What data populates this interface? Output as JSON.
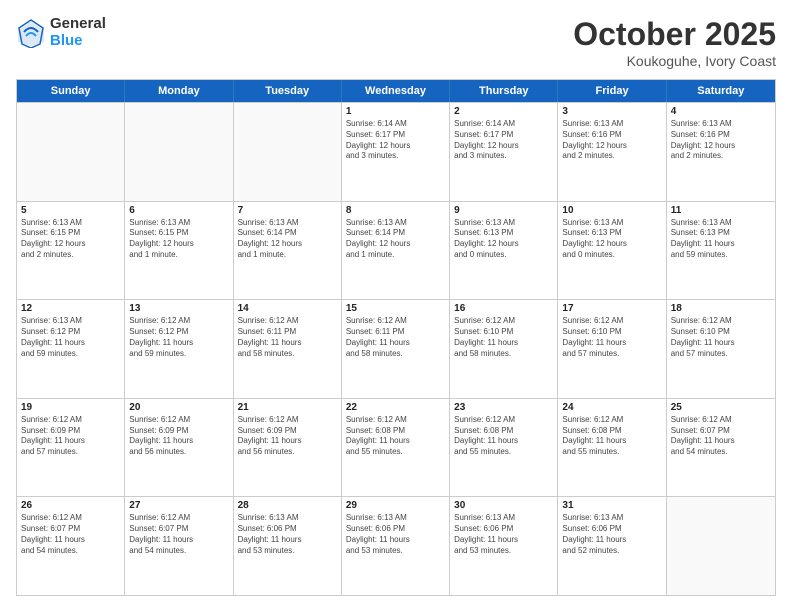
{
  "logo": {
    "general": "General",
    "blue": "Blue"
  },
  "title": "October 2025",
  "subtitle": "Koukoguhe, Ivory Coast",
  "days": [
    "Sunday",
    "Monday",
    "Tuesday",
    "Wednesday",
    "Thursday",
    "Friday",
    "Saturday"
  ],
  "weeks": [
    [
      {
        "day": "",
        "info": ""
      },
      {
        "day": "",
        "info": ""
      },
      {
        "day": "",
        "info": ""
      },
      {
        "day": "1",
        "info": "Sunrise: 6:14 AM\nSunset: 6:17 PM\nDaylight: 12 hours\nand 3 minutes."
      },
      {
        "day": "2",
        "info": "Sunrise: 6:14 AM\nSunset: 6:17 PM\nDaylight: 12 hours\nand 3 minutes."
      },
      {
        "day": "3",
        "info": "Sunrise: 6:13 AM\nSunset: 6:16 PM\nDaylight: 12 hours\nand 2 minutes."
      },
      {
        "day": "4",
        "info": "Sunrise: 6:13 AM\nSunset: 6:16 PM\nDaylight: 12 hours\nand 2 minutes."
      }
    ],
    [
      {
        "day": "5",
        "info": "Sunrise: 6:13 AM\nSunset: 6:15 PM\nDaylight: 12 hours\nand 2 minutes."
      },
      {
        "day": "6",
        "info": "Sunrise: 6:13 AM\nSunset: 6:15 PM\nDaylight: 12 hours\nand 1 minute."
      },
      {
        "day": "7",
        "info": "Sunrise: 6:13 AM\nSunset: 6:14 PM\nDaylight: 12 hours\nand 1 minute."
      },
      {
        "day": "8",
        "info": "Sunrise: 6:13 AM\nSunset: 6:14 PM\nDaylight: 12 hours\nand 1 minute."
      },
      {
        "day": "9",
        "info": "Sunrise: 6:13 AM\nSunset: 6:13 PM\nDaylight: 12 hours\nand 0 minutes."
      },
      {
        "day": "10",
        "info": "Sunrise: 6:13 AM\nSunset: 6:13 PM\nDaylight: 12 hours\nand 0 minutes."
      },
      {
        "day": "11",
        "info": "Sunrise: 6:13 AM\nSunset: 6:13 PM\nDaylight: 11 hours\nand 59 minutes."
      }
    ],
    [
      {
        "day": "12",
        "info": "Sunrise: 6:13 AM\nSunset: 6:12 PM\nDaylight: 11 hours\nand 59 minutes."
      },
      {
        "day": "13",
        "info": "Sunrise: 6:12 AM\nSunset: 6:12 PM\nDaylight: 11 hours\nand 59 minutes."
      },
      {
        "day": "14",
        "info": "Sunrise: 6:12 AM\nSunset: 6:11 PM\nDaylight: 11 hours\nand 58 minutes."
      },
      {
        "day": "15",
        "info": "Sunrise: 6:12 AM\nSunset: 6:11 PM\nDaylight: 11 hours\nand 58 minutes."
      },
      {
        "day": "16",
        "info": "Sunrise: 6:12 AM\nSunset: 6:10 PM\nDaylight: 11 hours\nand 58 minutes."
      },
      {
        "day": "17",
        "info": "Sunrise: 6:12 AM\nSunset: 6:10 PM\nDaylight: 11 hours\nand 57 minutes."
      },
      {
        "day": "18",
        "info": "Sunrise: 6:12 AM\nSunset: 6:10 PM\nDaylight: 11 hours\nand 57 minutes."
      }
    ],
    [
      {
        "day": "19",
        "info": "Sunrise: 6:12 AM\nSunset: 6:09 PM\nDaylight: 11 hours\nand 57 minutes."
      },
      {
        "day": "20",
        "info": "Sunrise: 6:12 AM\nSunset: 6:09 PM\nDaylight: 11 hours\nand 56 minutes."
      },
      {
        "day": "21",
        "info": "Sunrise: 6:12 AM\nSunset: 6:09 PM\nDaylight: 11 hours\nand 56 minutes."
      },
      {
        "day": "22",
        "info": "Sunrise: 6:12 AM\nSunset: 6:08 PM\nDaylight: 11 hours\nand 55 minutes."
      },
      {
        "day": "23",
        "info": "Sunrise: 6:12 AM\nSunset: 6:08 PM\nDaylight: 11 hours\nand 55 minutes."
      },
      {
        "day": "24",
        "info": "Sunrise: 6:12 AM\nSunset: 6:08 PM\nDaylight: 11 hours\nand 55 minutes."
      },
      {
        "day": "25",
        "info": "Sunrise: 6:12 AM\nSunset: 6:07 PM\nDaylight: 11 hours\nand 54 minutes."
      }
    ],
    [
      {
        "day": "26",
        "info": "Sunrise: 6:12 AM\nSunset: 6:07 PM\nDaylight: 11 hours\nand 54 minutes."
      },
      {
        "day": "27",
        "info": "Sunrise: 6:12 AM\nSunset: 6:07 PM\nDaylight: 11 hours\nand 54 minutes."
      },
      {
        "day": "28",
        "info": "Sunrise: 6:13 AM\nSunset: 6:06 PM\nDaylight: 11 hours\nand 53 minutes."
      },
      {
        "day": "29",
        "info": "Sunrise: 6:13 AM\nSunset: 6:06 PM\nDaylight: 11 hours\nand 53 minutes."
      },
      {
        "day": "30",
        "info": "Sunrise: 6:13 AM\nSunset: 6:06 PM\nDaylight: 11 hours\nand 53 minutes."
      },
      {
        "day": "31",
        "info": "Sunrise: 6:13 AM\nSunset: 6:06 PM\nDaylight: 11 hours\nand 52 minutes."
      },
      {
        "day": "",
        "info": ""
      }
    ]
  ]
}
